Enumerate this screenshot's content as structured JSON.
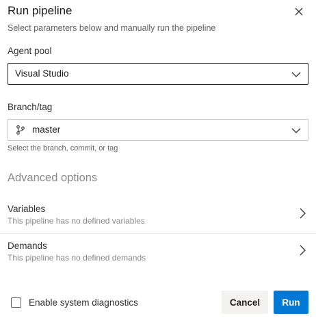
{
  "dialog": {
    "title": "Run pipeline",
    "subtitle": "Select parameters below and manually run the pipeline"
  },
  "agent_pool": {
    "label": "Agent pool",
    "selected": "Visual Studio"
  },
  "branch": {
    "label": "Branch/tag",
    "selected": "master",
    "hint": "Select the branch, commit, or tag"
  },
  "advanced": {
    "heading": "Advanced options",
    "rows": [
      {
        "title": "Variables",
        "subtitle": "This pipeline has no defined variables"
      },
      {
        "title": "Demands",
        "subtitle": "This pipeline has no defined demands"
      }
    ]
  },
  "footer": {
    "diagnostics_label": "Enable system diagnostics",
    "diagnostics_checked": false,
    "cancel_label": "Cancel",
    "run_label": "Run"
  },
  "colors": {
    "accent": "#0078d4",
    "secondary_button": "#f3f2f1",
    "muted_text": "#8a8886"
  },
  "icons": [
    "close-icon",
    "chevron-down-icon",
    "branch-icon",
    "chevron-right-icon"
  ]
}
